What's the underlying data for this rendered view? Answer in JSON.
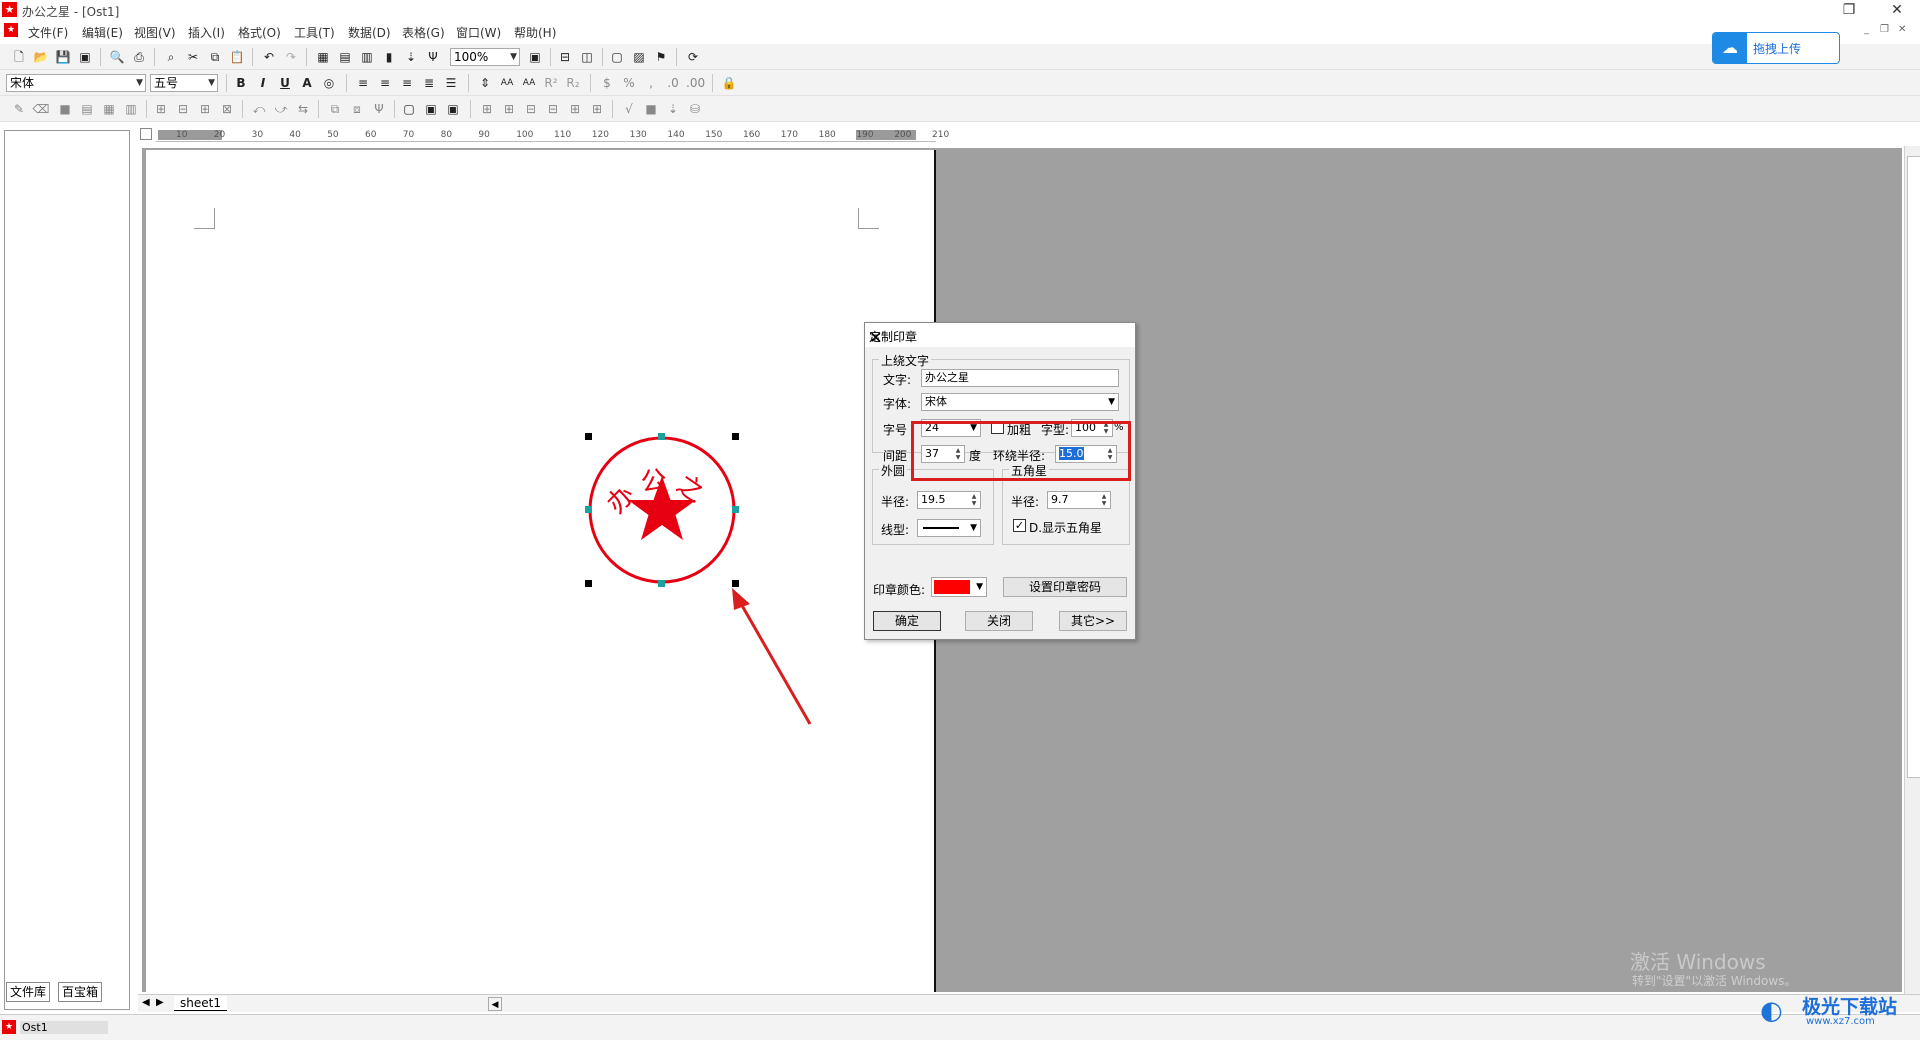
{
  "window": {
    "title": "办公之星 - [Ost1]",
    "controls": {
      "restore": "❐",
      "close": "✕",
      "mdi_min": "_",
      "mdi_restore": "❐",
      "mdi_close": "✕"
    }
  },
  "menu": [
    "文件(F)",
    "编辑(E)",
    "视图(V)",
    "插入(I)",
    "格式(O)",
    "工具(T)",
    "数据(D)",
    "表格(G)",
    "窗口(W)",
    "帮助(H)"
  ],
  "toolbar": {
    "zoom": "100%",
    "font_name": "宋体",
    "font_size": "五号",
    "bold": "B",
    "italic": "I",
    "underline": "U",
    "font_color": "A"
  },
  "upload_button": {
    "label": "拖拽上传"
  },
  "ruler": {
    "ticks": [
      "10",
      "20",
      "30",
      "40",
      "50",
      "60",
      "70",
      "80",
      "90",
      "100",
      "110",
      "120",
      "130",
      "140",
      "150",
      "160",
      "170",
      "180",
      "190",
      "200",
      "210"
    ]
  },
  "left_panel": {
    "tabs": [
      "文件库",
      "百宝箱"
    ]
  },
  "sheet_tabs": [
    "sheet1"
  ],
  "status": {
    "doc_name": "Ost1"
  },
  "stamp": {
    "text": "办公之星",
    "color": "#e60012"
  },
  "dialog": {
    "title": "定制印章",
    "top_text_group": "上绕文字",
    "text_label": "文字:",
    "text_value": "办公之星",
    "font_label": "字体:",
    "font_value": "宋体",
    "size_label": "字号",
    "size_value": "24",
    "bold_label": "加粗",
    "shape_label": "字型:",
    "shape_value": "100",
    "shape_unit": "%",
    "spacing_label": "间距",
    "spacing_value": "37",
    "spacing_unit": "度",
    "radius_label": "环绕半径:",
    "radius_value": "15.0",
    "outer_group": "外圆",
    "outer_radius_label": "半径:",
    "outer_radius_value": "19.5",
    "line_type_label": "线型:",
    "star_group": "五角星",
    "star_radius_label": "半径:",
    "star_radius_value": "9.7",
    "show_star_label": "D.显示五角星",
    "show_star_checked": true,
    "color_label": "印章颜色:",
    "color_value": "#ff0000",
    "password_button": "设置印章密码",
    "ok_button": "确定",
    "close_button": "关闭",
    "other_button": "其它>>"
  },
  "watermark": {
    "line1": "激活 Windows",
    "line2": "转到\"设置\"以激活 Windows。"
  },
  "site_logo": {
    "text": "极光下载站",
    "url_text": "www.xz7.com"
  }
}
